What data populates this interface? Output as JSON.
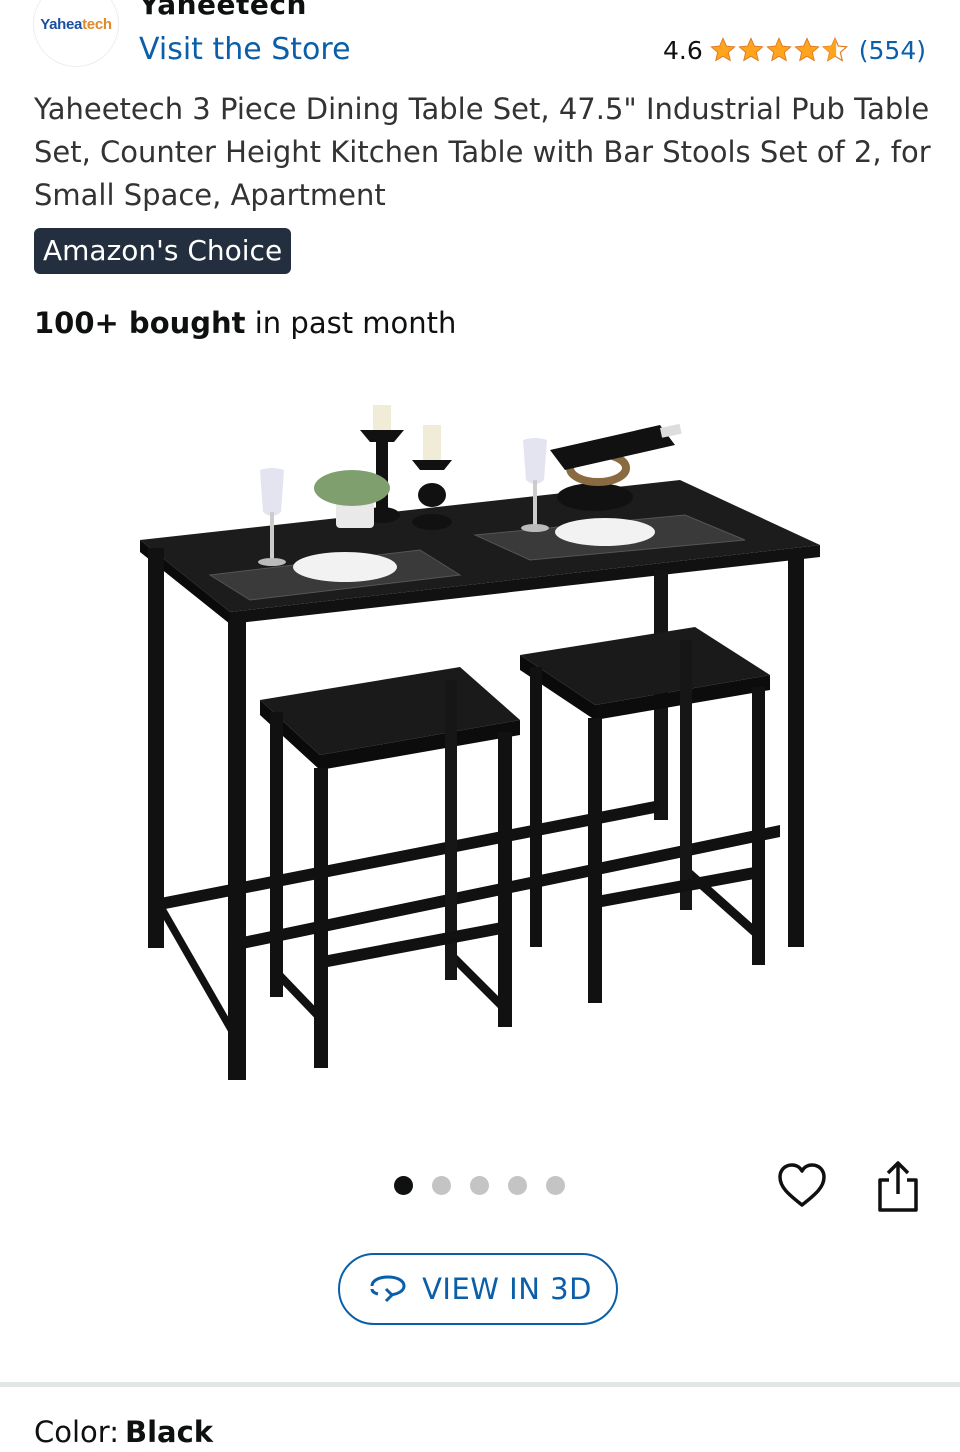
{
  "store": {
    "logo_text_part1": "Yahea",
    "logo_text_part2": "tech",
    "brand_name": "Yaheetech",
    "visit_link": "Visit the Store"
  },
  "rating": {
    "value": "4.6",
    "stars": 4.6,
    "count": "(554)",
    "star_color": "#ffa41c"
  },
  "product": {
    "title": "Yaheetech 3 Piece Dining Table Set, 47.5\" Industrial Pub Table Set, Counter Height Kitchen Table with Bar Stools Set of 2, for Small Space, Apartment",
    "badge": "Amazon's Choice",
    "bought_strong": "100+ bought",
    "bought_rest": " in past month"
  },
  "gallery": {
    "image_count": 5,
    "active_index": 0
  },
  "actions": {
    "view_3d_label": "VIEW IN 3D"
  },
  "variation": {
    "label": "Color:",
    "value": "Black"
  },
  "colors": {
    "link": "#0a5fa8",
    "badge_bg": "#232f3e",
    "star": "#ffa41c",
    "text": "#0f1111"
  }
}
